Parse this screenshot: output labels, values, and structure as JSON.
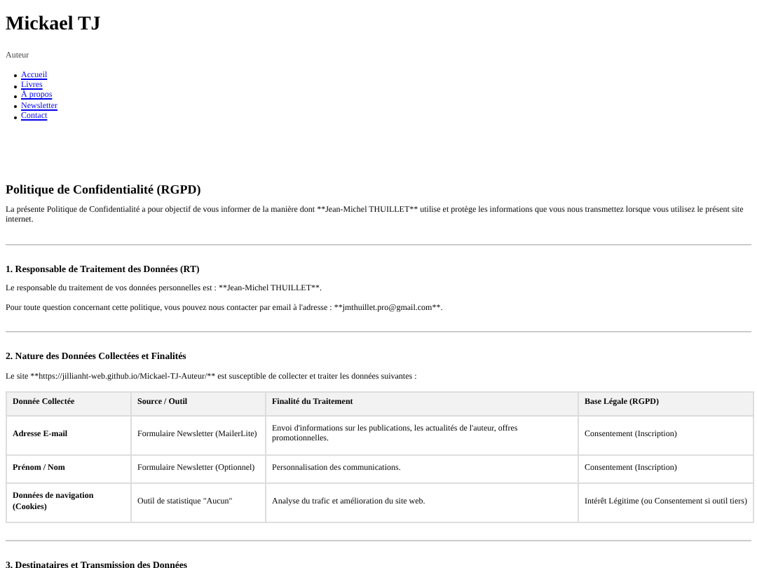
{
  "header": {
    "title": "Mickael TJ",
    "subtitle": "Auteur",
    "nav": [
      {
        "label": "Accueil"
      },
      {
        "label": "Livres"
      },
      {
        "label": "À propos"
      },
      {
        "label": "Newsletter"
      },
      {
        "label": "Contact"
      }
    ]
  },
  "page_title": "Politique de Confidentialité (RGPD)",
  "intro": "La présente Politique de Confidentialité a pour objectif de vous informer de la manière dont **Jean-Michel THUILLET** utilise et protège les informations que vous nous transmettez lorsque vous utilisez le présent site internet.",
  "sections": [
    {
      "heading": "1. Responsable de Traitement des Données (RT)",
      "paragraphs": [
        "Le responsable du traitement de vos données personnelles est : **Jean-Michel THUILLET**.",
        "Pour toute question concernant cette politique, vous pouvez nous contacter par email à l'adresse : **jmthuillet.pro@gmail.com**."
      ]
    },
    {
      "heading": "2. Nature des Données Collectées et Finalités",
      "paragraphs": [
        "Le site **https://jillianht-web.github.io/Mickael-TJ-Auteur/** est susceptible de collecter et traiter les données suivantes :"
      ],
      "table": {
        "columns": [
          "Donnée Collectée",
          "Source / Outil",
          "Finalité du Traitement",
          "Base Légale (RGPD)"
        ],
        "rows": [
          [
            "Adresse E-mail",
            "Formulaire Newsletter (MailerLite)",
            "Envoi d'informations sur les publications, les actualités de l'auteur, offres promotionnelles.",
            "Consentement (Inscription)"
          ],
          [
            "Prénom / Nom",
            "Formulaire Newsletter (Optionnel)",
            "Personnalisation des communications.",
            "Consentement (Inscription)"
          ],
          [
            "Données de navigation (Cookies)",
            "Outil de statistique \"Aucun\"",
            "Analyse du trafic et amélioration du site web.",
            "Intérêt Légitime (ou Consentement si outil tiers)"
          ]
        ]
      }
    },
    {
      "heading": "3. Destinataires et Transmission des Données"
    }
  ]
}
